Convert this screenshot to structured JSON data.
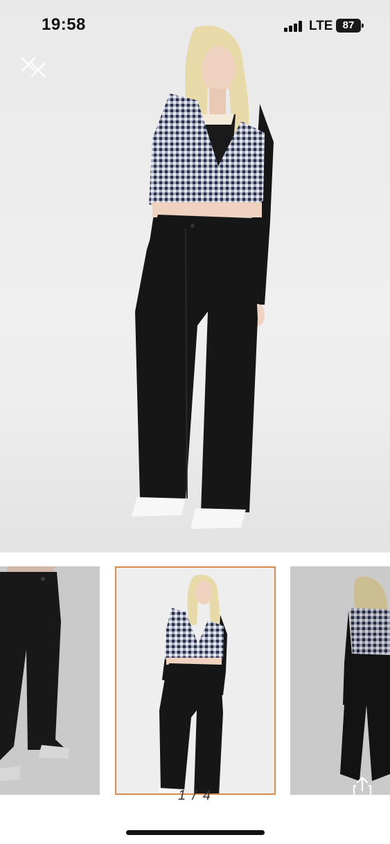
{
  "status_bar": {
    "time": "19:58",
    "network": "LTE",
    "battery": "87"
  },
  "gallery": {
    "current_page": 1,
    "total_pages": 4,
    "pager_text": "1 / 4",
    "selected_border_color": "#d98a4e"
  },
  "icons": {
    "close": "close-icon",
    "share": "share-icon"
  },
  "colors": {
    "background": "#ffffff",
    "photo_background": "#ececec",
    "vest_check": "#6a7190",
    "garment_black": "#161616"
  }
}
